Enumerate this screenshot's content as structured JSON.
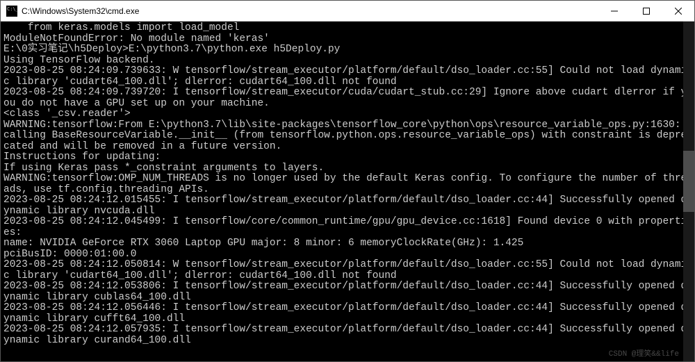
{
  "titlebar": {
    "title": "C:\\Windows\\System32\\cmd.exe"
  },
  "terminal": {
    "lines": [
      "    from keras.models import load_model",
      "ModuleNotFoundError: No module named 'keras'",
      "",
      "E:\\0实习笔记\\h5Deploy>E:\\python3.7\\python.exe h5Deploy.py",
      "Using TensorFlow backend.",
      "2023-08-25 08:24:09.739633: W tensorflow/stream_executor/platform/default/dso_loader.cc:55] Could not load dynamic library 'cudart64_100.dll'; dlerror: cudart64_100.dll not found",
      "2023-08-25 08:24:09.739720: I tensorflow/stream_executor/cuda/cudart_stub.cc:29] Ignore above cudart dlerror if you do not have a GPU set up on your machine.",
      "<class '_csv.reader'>",
      "WARNING:tensorflow:From E:\\python3.7\\lib\\site-packages\\tensorflow_core\\python\\ops\\resource_variable_ops.py:1630: calling BaseResourceVariable.__init__ (from tensorflow.python.ops.resource_variable_ops) with constraint is deprecated and will be removed in a future version.",
      "Instructions for updating:",
      "If using Keras pass *_constraint arguments to layers.",
      "WARNING:tensorflow:OMP_NUM_THREADS is no longer used by the default Keras config. To configure the number of threads, use tf.config.threading APIs.",
      "2023-08-25 08:24:12.015455: I tensorflow/stream_executor/platform/default/dso_loader.cc:44] Successfully opened dynamic library nvcuda.dll",
      "2023-08-25 08:24:12.045499: I tensorflow/core/common_runtime/gpu/gpu_device.cc:1618] Found device 0 with properties:",
      "name: NVIDIA GeForce RTX 3060 Laptop GPU major: 8 minor: 6 memoryClockRate(GHz): 1.425",
      "pciBusID: 0000:01:00.0",
      "2023-08-25 08:24:12.050814: W tensorflow/stream_executor/platform/default/dso_loader.cc:55] Could not load dynamic library 'cudart64_100.dll'; dlerror: cudart64_100.dll not found",
      "2023-08-25 08:24:12.053806: I tensorflow/stream_executor/platform/default/dso_loader.cc:44] Successfully opened dynamic library cublas64_100.dll",
      "2023-08-25 08:24:12.056446: I tensorflow/stream_executor/platform/default/dso_loader.cc:44] Successfully opened dynamic library cufft64_100.dll",
      "2023-08-25 08:24:12.057935: I tensorflow/stream_executor/platform/default/dso_loader.cc:44] Successfully opened dynamic library curand64_100.dll"
    ]
  },
  "watermark": "CSDN @理笑&&life"
}
